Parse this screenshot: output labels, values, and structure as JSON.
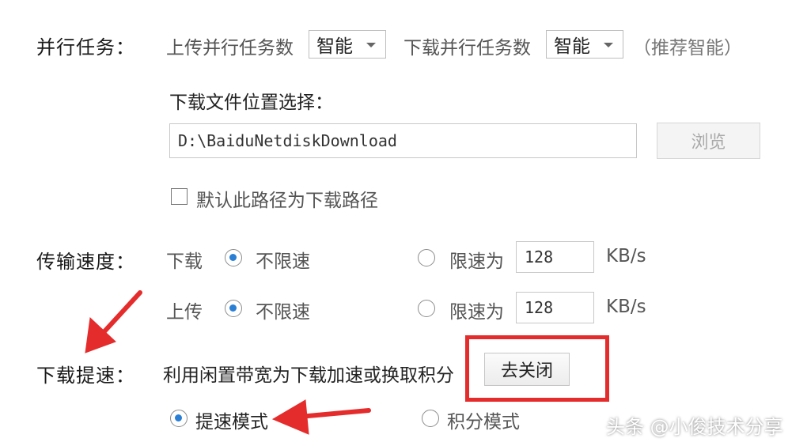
{
  "parallel": {
    "label": "并行任务：",
    "upload_label": "上传并行任务数",
    "upload_value": "智能",
    "download_label": "下载并行任务数",
    "download_value": "智能",
    "hint": "（推荐智能）"
  },
  "download_location": {
    "label": "下载文件位置选择：",
    "path": "D:\\BaiduNetdiskDownload",
    "browse_label": "浏览",
    "default_checkbox_label": "默认此路径为下载路径",
    "default_checked": false
  },
  "speed": {
    "label": "传输速度：",
    "download": {
      "label": "下载",
      "unlimited_label": "不限速",
      "limit_label": "限速为",
      "limit_value": "128",
      "unit": "KB/s",
      "selected": "unlimited"
    },
    "upload": {
      "label": "上传",
      "unlimited_label": "不限速",
      "limit_label": "限速为",
      "limit_value": "128",
      "unit": "KB/s",
      "selected": "unlimited"
    }
  },
  "accelerate": {
    "label": "下载提速：",
    "description": "利用闲置带宽为下载加速或换取积分",
    "close_button": "去关闭",
    "mode_speed_label": "提速模式",
    "mode_points_label": "积分模式",
    "selected_mode": "speed"
  },
  "annotations": {
    "arrow_color": "#e52c2c",
    "box_color": "#e52c2c"
  },
  "watermark": "头条 @小俊技术分享",
  "colors": {
    "radio_accent": "#2a7fd4"
  }
}
